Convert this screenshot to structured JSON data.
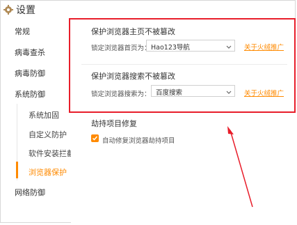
{
  "window": {
    "title": "设置"
  },
  "sidebar": {
    "items": [
      {
        "label": "常规"
      },
      {
        "label": "病毒查杀"
      },
      {
        "label": "病毒防御"
      },
      {
        "label": "系统防御"
      },
      {
        "label": "网络防御"
      }
    ],
    "subitems": [
      {
        "label": "系统加固"
      },
      {
        "label": "自定义防护"
      },
      {
        "label": "软件安装拦截"
      },
      {
        "label": "浏览器保护",
        "active": true
      }
    ]
  },
  "homepage_section": {
    "title": "保护浏览器主页不被篡改",
    "field_label": "锁定浏览器首页为：",
    "selected": "Hao123导航",
    "link": "关于火绒推广"
  },
  "search_section": {
    "title": "保护浏览器搜索不被篡改",
    "field_label": "锁定浏览器搜索为：",
    "selected": "百度搜索",
    "link": "关于火绒推广"
  },
  "hijack_section": {
    "title": "劫持项目修复",
    "checkbox_label": "自动修复浏览器劫持项目",
    "checked": true
  },
  "colors": {
    "accent": "#ff8a00",
    "highlight_box": "#e81d2a"
  }
}
